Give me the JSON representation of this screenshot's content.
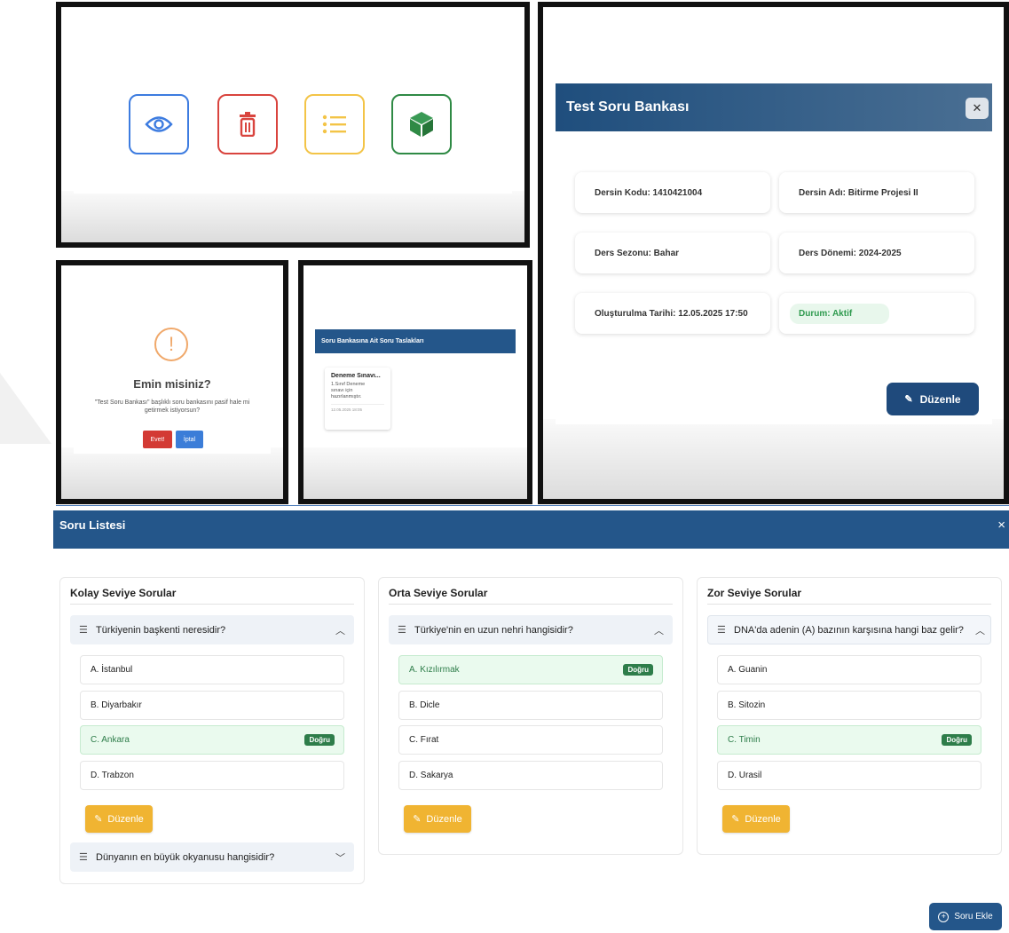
{
  "panel_actions": {
    "icons": [
      "eye-icon",
      "trash-icon",
      "list-icon",
      "cube-icon"
    ],
    "colors": [
      "#3d7ce0",
      "#d9443e",
      "#f3c447",
      "#2f8a45"
    ]
  },
  "confirm_dialog": {
    "title": "Emin misiniz?",
    "message_line1": "\"Test Soru Bankası\" başlıklı soru bankasını pasif hale mi",
    "message_line2": "getirmek istiyorsun?",
    "yes_label": "Evet!",
    "cancel_label": "İptal"
  },
  "drafts_panel": {
    "header": "Soru Bankasına Ait Soru Taslakları",
    "card_title": "Deneme Sınavı...",
    "card_desc_line1": "1.Sınıf Deneme",
    "card_desc_line2": "sınavı için",
    "card_desc_line3": "hazırlanmıştır.",
    "card_date": "12.05.2025 18:05"
  },
  "detail_modal": {
    "title": "Test Soru Bankası",
    "close_label": "✕",
    "fields": [
      "Dersin Kodu: 1410421004",
      "Dersin Adı: Bitirme Projesi II",
      "Ders Sezonu: Bahar",
      "Ders Dönemi: 2024-2025",
      "Oluşturulma Tarihi: 12.05.2025 17:50",
      "Durum: Aktif"
    ],
    "edit_label": "Düzenle"
  },
  "soru_listesi": {
    "title": "Soru Listesi",
    "close_label": "×",
    "columns": [
      {
        "title": "Kolay Seviye Sorular",
        "question": "Türkiyenin başkenti neresidir?",
        "options": [
          "A. İstanbul",
          "B. Diyarbakır",
          "C. Ankara",
          "D. Trabzon"
        ],
        "correct_index": 2,
        "edit_label": "Düzenle",
        "collapsed_question": "Dünyanın en büyük okyanusu hangisidir?"
      },
      {
        "title": "Orta Seviye Sorular",
        "question": "Türkiye'nin en uzun nehri hangisidir?",
        "options": [
          "A. Kızılırmak",
          "B. Dicle",
          "C. Fırat",
          "D. Sakarya"
        ],
        "correct_index": 0,
        "edit_label": "Düzenle"
      },
      {
        "title": "Zor Seviye Sorular",
        "question": "DNA'da adenin (A) bazının karşısına hangi baz gelir?",
        "options": [
          "A. Guanin",
          "B. Sitozin",
          "C. Timin",
          "D. Urasil"
        ],
        "correct_index": 2,
        "edit_label": "Düzenle"
      }
    ],
    "correct_badge": "Doğru",
    "add_button_label": "Soru Ekle"
  }
}
